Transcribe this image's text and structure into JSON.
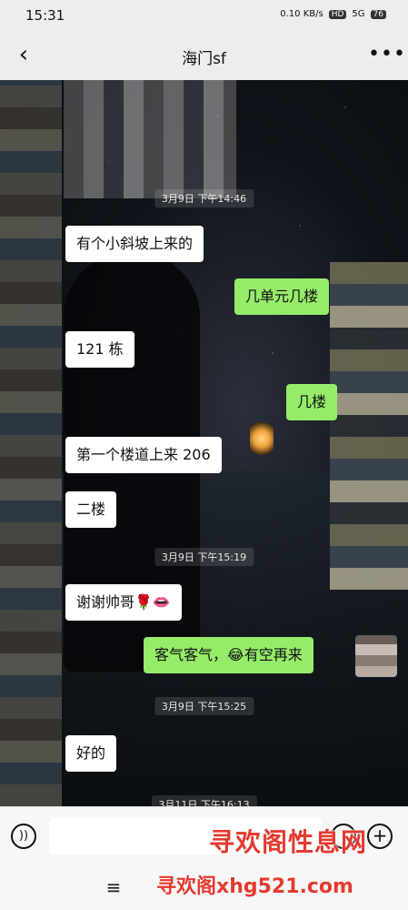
{
  "status_bar": {
    "time": "15:31",
    "network": "0.10 KB/s",
    "hd": "HD",
    "signal": "5G",
    "battery": "76"
  },
  "header": {
    "back_icon": "chevron-left-icon",
    "title": "海门sf",
    "more_icon": "ellipsis-icon"
  },
  "timestamps": {
    "t1": "3月9日 下午14:46",
    "t2": "3月9日 下午15:19",
    "t3": "3月9日 下午15:25",
    "t4": "3月11日 下午16:13"
  },
  "messages": [
    {
      "side": "recv",
      "text": "有个小斜坡上来的"
    },
    {
      "side": "sent",
      "text": "几单元几楼"
    },
    {
      "side": "recv",
      "text": "121 栋"
    },
    {
      "side": "sent",
      "text": "几楼"
    },
    {
      "side": "recv",
      "text": "第一个楼道上来 206"
    },
    {
      "side": "recv",
      "text": "二楼"
    },
    {
      "side": "recv",
      "text": "谢谢帅哥🌹👄"
    },
    {
      "side": "sent",
      "text": "客气客气，😂有空再来"
    },
    {
      "side": "recv",
      "text": "好的"
    }
  ],
  "input_bar": {
    "voice_icon": "voice-icon",
    "emoji_icon": "emoji-icon",
    "plus_icon": "plus-icon"
  },
  "nav_bar": {
    "menu_icon": "menu-icon"
  },
  "watermark": {
    "line1": "寻欢阁性息网",
    "line2": "寻欢阁xhg521.com"
  },
  "colors": {
    "sent_bubble": "#95ec69",
    "recv_bubble": "#ffffff",
    "header_bg": "#ededed",
    "watermark": "#e43a2f"
  }
}
